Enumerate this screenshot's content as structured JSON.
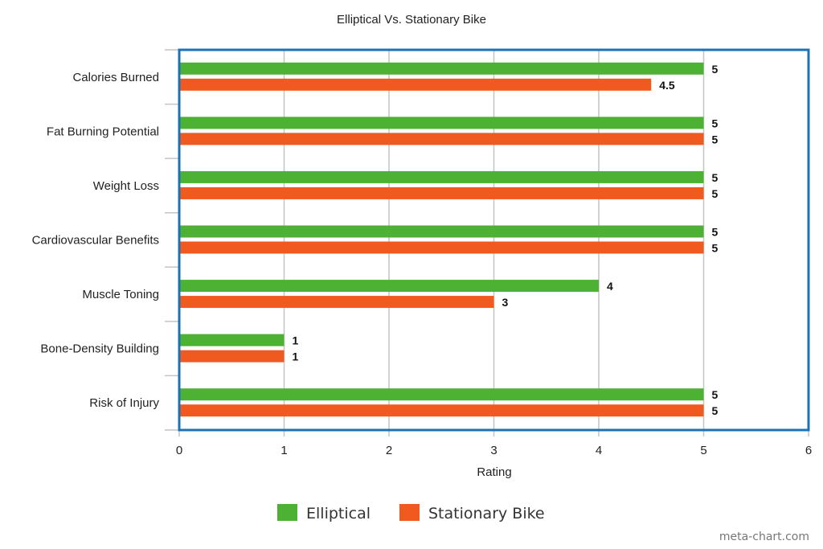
{
  "chart_data": {
    "type": "bar",
    "orientation": "horizontal",
    "title": "Elliptical Vs. Stationary Bike",
    "xlabel": "Rating",
    "ylabel": "",
    "xlim": [
      0,
      6
    ],
    "xticks": [
      "0",
      "1",
      "2",
      "3",
      "4",
      "5",
      "6"
    ],
    "grid": true,
    "legend_position": "bottom",
    "categories": [
      "Calories Burned",
      "Fat Burning Potential",
      "Weight Loss",
      "Cardiovascular Benefits",
      "Muscle Toning",
      "Bone-Density Building",
      "Risk of Injury"
    ],
    "series": [
      {
        "name": "Elliptical",
        "color": "#4db234",
        "values": [
          5,
          5,
          5,
          5,
          4,
          1,
          5
        ],
        "labels": [
          "5",
          "5",
          "5",
          "5",
          "4",
          "1",
          "5"
        ]
      },
      {
        "name": "Stationary Bike",
        "color": "#f05a1e",
        "values": [
          4.5,
          5,
          5,
          5,
          3,
          1,
          5
        ],
        "labels": [
          "4.5",
          "5",
          "5",
          "5",
          "3",
          "1",
          "5"
        ]
      }
    ],
    "frame_color": "#1a73b8",
    "credit": "meta-chart.com"
  }
}
